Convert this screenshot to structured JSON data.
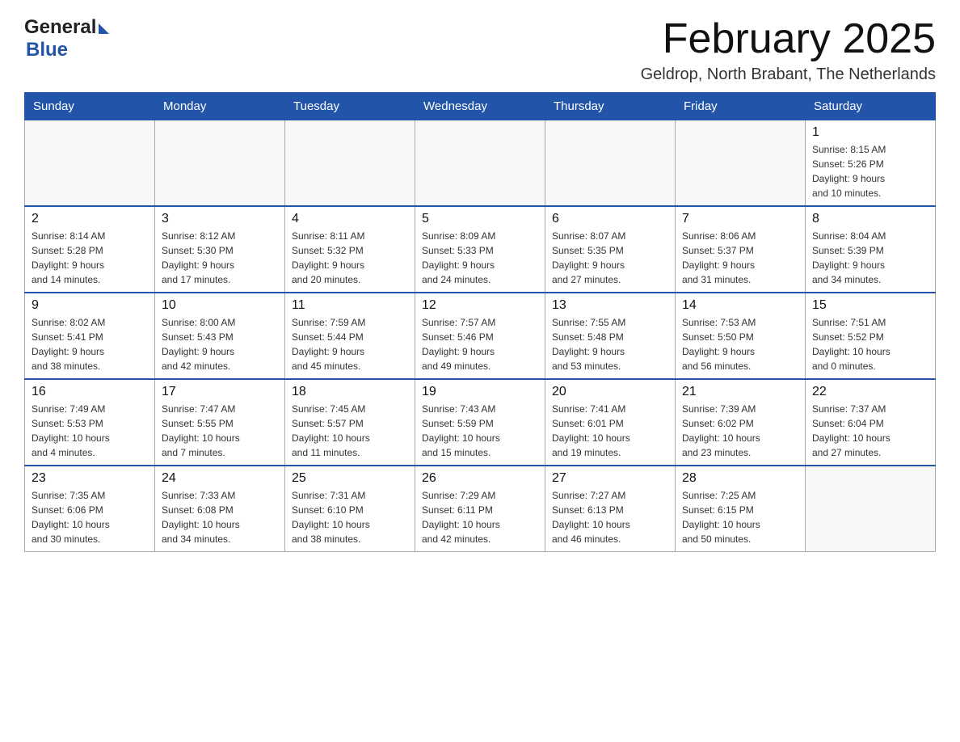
{
  "header": {
    "logo_general": "General",
    "logo_blue": "Blue",
    "title": "February 2025",
    "location": "Geldrop, North Brabant, The Netherlands"
  },
  "weekdays": [
    "Sunday",
    "Monday",
    "Tuesday",
    "Wednesday",
    "Thursday",
    "Friday",
    "Saturday"
  ],
  "weeks": [
    [
      {
        "day": "",
        "info": ""
      },
      {
        "day": "",
        "info": ""
      },
      {
        "day": "",
        "info": ""
      },
      {
        "day": "",
        "info": ""
      },
      {
        "day": "",
        "info": ""
      },
      {
        "day": "",
        "info": ""
      },
      {
        "day": "1",
        "info": "Sunrise: 8:15 AM\nSunset: 5:26 PM\nDaylight: 9 hours\nand 10 minutes."
      }
    ],
    [
      {
        "day": "2",
        "info": "Sunrise: 8:14 AM\nSunset: 5:28 PM\nDaylight: 9 hours\nand 14 minutes."
      },
      {
        "day": "3",
        "info": "Sunrise: 8:12 AM\nSunset: 5:30 PM\nDaylight: 9 hours\nand 17 minutes."
      },
      {
        "day": "4",
        "info": "Sunrise: 8:11 AM\nSunset: 5:32 PM\nDaylight: 9 hours\nand 20 minutes."
      },
      {
        "day": "5",
        "info": "Sunrise: 8:09 AM\nSunset: 5:33 PM\nDaylight: 9 hours\nand 24 minutes."
      },
      {
        "day": "6",
        "info": "Sunrise: 8:07 AM\nSunset: 5:35 PM\nDaylight: 9 hours\nand 27 minutes."
      },
      {
        "day": "7",
        "info": "Sunrise: 8:06 AM\nSunset: 5:37 PM\nDaylight: 9 hours\nand 31 minutes."
      },
      {
        "day": "8",
        "info": "Sunrise: 8:04 AM\nSunset: 5:39 PM\nDaylight: 9 hours\nand 34 minutes."
      }
    ],
    [
      {
        "day": "9",
        "info": "Sunrise: 8:02 AM\nSunset: 5:41 PM\nDaylight: 9 hours\nand 38 minutes."
      },
      {
        "day": "10",
        "info": "Sunrise: 8:00 AM\nSunset: 5:43 PM\nDaylight: 9 hours\nand 42 minutes."
      },
      {
        "day": "11",
        "info": "Sunrise: 7:59 AM\nSunset: 5:44 PM\nDaylight: 9 hours\nand 45 minutes."
      },
      {
        "day": "12",
        "info": "Sunrise: 7:57 AM\nSunset: 5:46 PM\nDaylight: 9 hours\nand 49 minutes."
      },
      {
        "day": "13",
        "info": "Sunrise: 7:55 AM\nSunset: 5:48 PM\nDaylight: 9 hours\nand 53 minutes."
      },
      {
        "day": "14",
        "info": "Sunrise: 7:53 AM\nSunset: 5:50 PM\nDaylight: 9 hours\nand 56 minutes."
      },
      {
        "day": "15",
        "info": "Sunrise: 7:51 AM\nSunset: 5:52 PM\nDaylight: 10 hours\nand 0 minutes."
      }
    ],
    [
      {
        "day": "16",
        "info": "Sunrise: 7:49 AM\nSunset: 5:53 PM\nDaylight: 10 hours\nand 4 minutes."
      },
      {
        "day": "17",
        "info": "Sunrise: 7:47 AM\nSunset: 5:55 PM\nDaylight: 10 hours\nand 7 minutes."
      },
      {
        "day": "18",
        "info": "Sunrise: 7:45 AM\nSunset: 5:57 PM\nDaylight: 10 hours\nand 11 minutes."
      },
      {
        "day": "19",
        "info": "Sunrise: 7:43 AM\nSunset: 5:59 PM\nDaylight: 10 hours\nand 15 minutes."
      },
      {
        "day": "20",
        "info": "Sunrise: 7:41 AM\nSunset: 6:01 PM\nDaylight: 10 hours\nand 19 minutes."
      },
      {
        "day": "21",
        "info": "Sunrise: 7:39 AM\nSunset: 6:02 PM\nDaylight: 10 hours\nand 23 minutes."
      },
      {
        "day": "22",
        "info": "Sunrise: 7:37 AM\nSunset: 6:04 PM\nDaylight: 10 hours\nand 27 minutes."
      }
    ],
    [
      {
        "day": "23",
        "info": "Sunrise: 7:35 AM\nSunset: 6:06 PM\nDaylight: 10 hours\nand 30 minutes."
      },
      {
        "day": "24",
        "info": "Sunrise: 7:33 AM\nSunset: 6:08 PM\nDaylight: 10 hours\nand 34 minutes."
      },
      {
        "day": "25",
        "info": "Sunrise: 7:31 AM\nSunset: 6:10 PM\nDaylight: 10 hours\nand 38 minutes."
      },
      {
        "day": "26",
        "info": "Sunrise: 7:29 AM\nSunset: 6:11 PM\nDaylight: 10 hours\nand 42 minutes."
      },
      {
        "day": "27",
        "info": "Sunrise: 7:27 AM\nSunset: 6:13 PM\nDaylight: 10 hours\nand 46 minutes."
      },
      {
        "day": "28",
        "info": "Sunrise: 7:25 AM\nSunset: 6:15 PM\nDaylight: 10 hours\nand 50 minutes."
      },
      {
        "day": "",
        "info": ""
      }
    ]
  ]
}
